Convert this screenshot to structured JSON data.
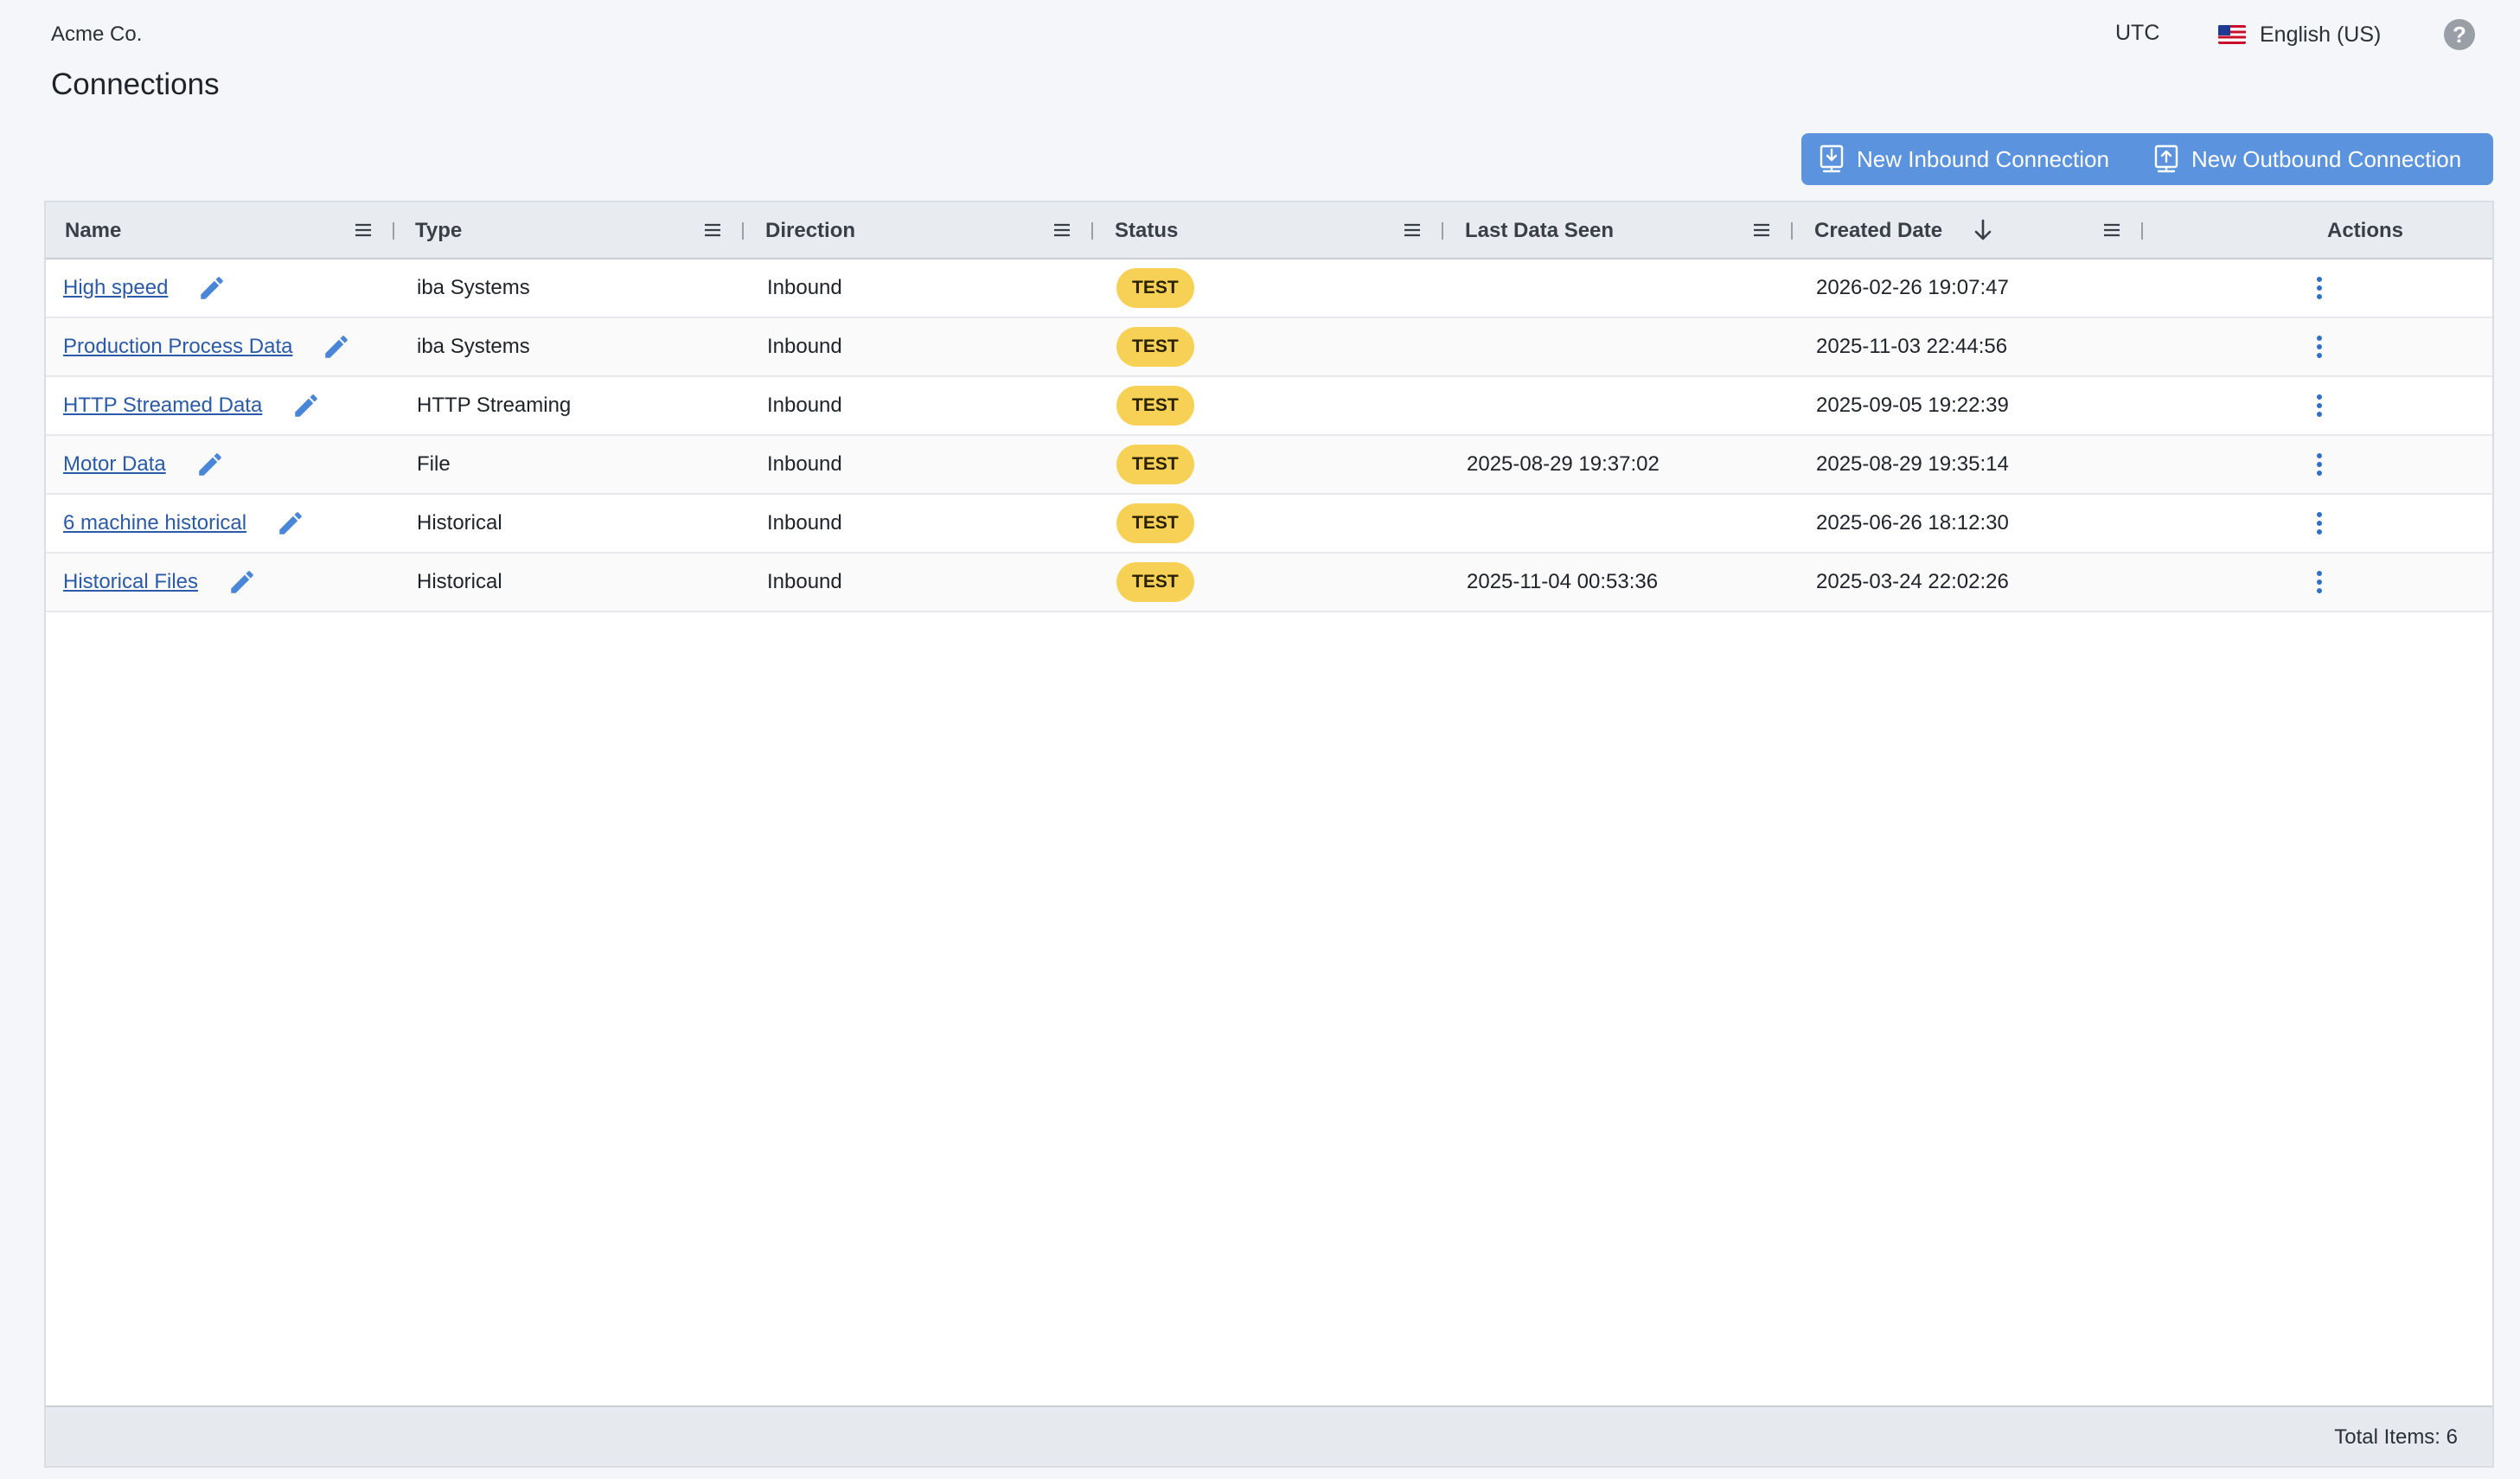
{
  "header": {
    "org_name": "Acme Co.",
    "timezone": "UTC",
    "language": "English (US)",
    "help_symbol": "?",
    "page_title": "Connections"
  },
  "actions": {
    "new_inbound": "New Inbound Connection",
    "new_outbound": "New Outbound Connection",
    "accent_color": "#5b93de"
  },
  "table": {
    "columns": [
      "Name",
      "Type",
      "Direction",
      "Status",
      "Last Data Seen",
      "Created Date",
      "Actions"
    ],
    "sort": {
      "column": "Created Date",
      "direction": "descending"
    },
    "rows": [
      {
        "name": "High speed",
        "type": "iba Systems",
        "direction": "Inbound",
        "status": "TEST",
        "last_seen": "",
        "created": "2026-02-26 19:07:47"
      },
      {
        "name": "Production Process Data",
        "type": "iba Systems",
        "direction": "Inbound",
        "status": "TEST",
        "last_seen": "",
        "created": "2025-11-03 22:44:56"
      },
      {
        "name": "HTTP Streamed Data",
        "type": "HTTP Streaming",
        "direction": "Inbound",
        "status": "TEST",
        "last_seen": "",
        "created": "2025-09-05 19:22:39"
      },
      {
        "name": "Motor Data",
        "type": "File",
        "direction": "Inbound",
        "status": "TEST",
        "last_seen": "2025-08-29 19:37:02",
        "created": "2025-08-29 19:35:14"
      },
      {
        "name": "6 machine historical",
        "type": "Historical",
        "direction": "Inbound",
        "status": "TEST",
        "last_seen": "",
        "created": "2025-06-26 18:12:30"
      },
      {
        "name": "Historical Files",
        "type": "Historical",
        "direction": "Inbound",
        "status": "TEST",
        "last_seen": "2025-11-04 00:53:36",
        "created": "2025-03-24 22:02:26"
      }
    ],
    "footer": {
      "total_items": "Total Items: 6"
    },
    "badge_color": "#f7d155",
    "link_color": "#2a5aa8"
  },
  "icons": {
    "edit": "pencil-icon",
    "column_menu": "hamburger-menu-icon",
    "row_actions": "kebab-menu-icon",
    "inbound": "download-tray-icon",
    "outbound": "upload-tray-icon",
    "sort": "arrow-down-icon",
    "help": "question-circle-icon",
    "language": "us-flag-icon"
  }
}
